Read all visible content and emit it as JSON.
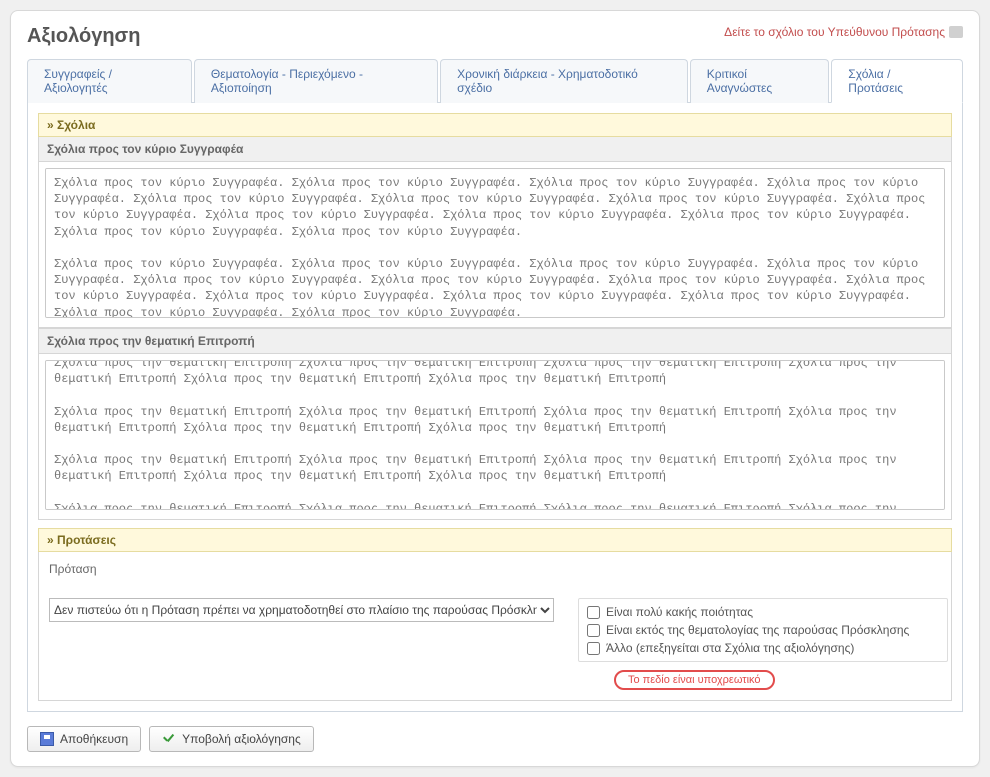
{
  "header": {
    "title": "Αξιολόγηση",
    "link_text": "Δείτε το σχόλιο του Υπεύθυνου Πρότασης"
  },
  "tabs": [
    {
      "label": "Συγγραφείς / Αξιολογητές"
    },
    {
      "label": "Θεματολογία - Περιεχόμενο - Αξιοποίηση"
    },
    {
      "label": "Χρονική διάρκεια - Χρηματοδοτικό σχέδιο"
    },
    {
      "label": "Κριτικοί Αναγνώστες"
    },
    {
      "label": "Σχόλια / Προτάσεις"
    }
  ],
  "sections": {
    "comments_title": "» Σχόλια",
    "author_label": "Σχόλια προς τον κύριο Συγγραφέα",
    "author_text": "Σχόλια προς τον κύριο Συγγραφέα. Σχόλια προς τον κύριο Συγγραφέα. Σχόλια προς τον κύριο Συγγραφέα. Σχόλια προς τον κύριο Συγγραφέα. Σχόλια προς τον κύριο Συγγραφέα. Σχόλια προς τον κύριο Συγγραφέα. Σχόλια προς τον κύριο Συγγραφέα. Σχόλια προς τον κύριο Συγγραφέα. Σχόλια προς τον κύριο Συγγραφέα. Σχόλια προς τον κύριο Συγγραφέα. Σχόλια προς τον κύριο Συγγραφέα. Σχόλια προς τον κύριο Συγγραφέα. Σχόλια προς τον κύριο Συγγραφέα.\n\nΣχόλια προς τον κύριο Συγγραφέα. Σχόλια προς τον κύριο Συγγραφέα. Σχόλια προς τον κύριο Συγγραφέα. Σχόλια προς τον κύριο Συγγραφέα. Σχόλια προς τον κύριο Συγγραφέα. Σχόλια προς τον κύριο Συγγραφέα. Σχόλια προς τον κύριο Συγγραφέα. Σχόλια προς τον κύριο Συγγραφέα. Σχόλια προς τον κύριο Συγγραφέα. Σχόλια προς τον κύριο Συγγραφέα. Σχόλια προς τον κύριο Συγγραφέα. Σχόλια προς τον κύριο Συγγραφέα. Σχόλια προς τον κύριο Συγγραφέα.",
    "committee_label": "Σχόλια προς την θεματική Επιτροπή",
    "committee_text": "Σχόλια προς την θεματική Επιτροπή Σχόλια προς την θεματική Επιτροπή Σχόλια προς την θεματική Επιτροπή Σχόλια προς την θεματική Επιτροπή Σχόλια προς την θεματική Επιτροπή Σχόλια προς την θεματική Επιτροπή\n\nΣχόλια προς την θεματική Επιτροπή Σχόλια προς την θεματική Επιτροπή Σχόλια προς την θεματική Επιτροπή Σχόλια προς την θεματική Επιτροπή Σχόλια προς την θεματική Επιτροπή Σχόλια προς την θεματική Επιτροπή\n\nΣχόλια προς την θεματική Επιτροπή Σχόλια προς την θεματική Επιτροπή Σχόλια προς την θεματική Επιτροπή Σχόλια προς την θεματική Επιτροπή Σχόλια προς την θεματική Επιτροπή Σχόλια προς την θεματική Επιτροπή\n\nΣχόλια προς την θεματική Επιτροπή Σχόλια προς την θεματική Επιτροπή Σχόλια προς την θεματική Επιτροπή Σχόλια προς την θεματική Επιτροπή Σχόλια προς την θεματική Επιτροπή Σχόλια προς την θεματική Επιτροπή",
    "proposals_title": "» Προτάσεις",
    "proposal_label": "Πρόταση",
    "proposal_selected": "Δεν πιστεύω ότι η Πρόταση πρέπει να χρηματοδοτηθεί στο πλαίσιο της παρούσας Πρόσκλησης",
    "checks": [
      "Είναι πολύ κακής ποιότητας",
      "Είναι εκτός της θεματολογίας της παρούσας Πρόσκλησης",
      "Άλλο (επεξηγείται στα Σχόλια της αξιολόγησης)"
    ],
    "required_text": "Το πεδίο είναι υποχρεωτικό"
  },
  "actions": {
    "save": "Αποθήκευση",
    "submit": "Υποβολή αξιολόγησης"
  }
}
